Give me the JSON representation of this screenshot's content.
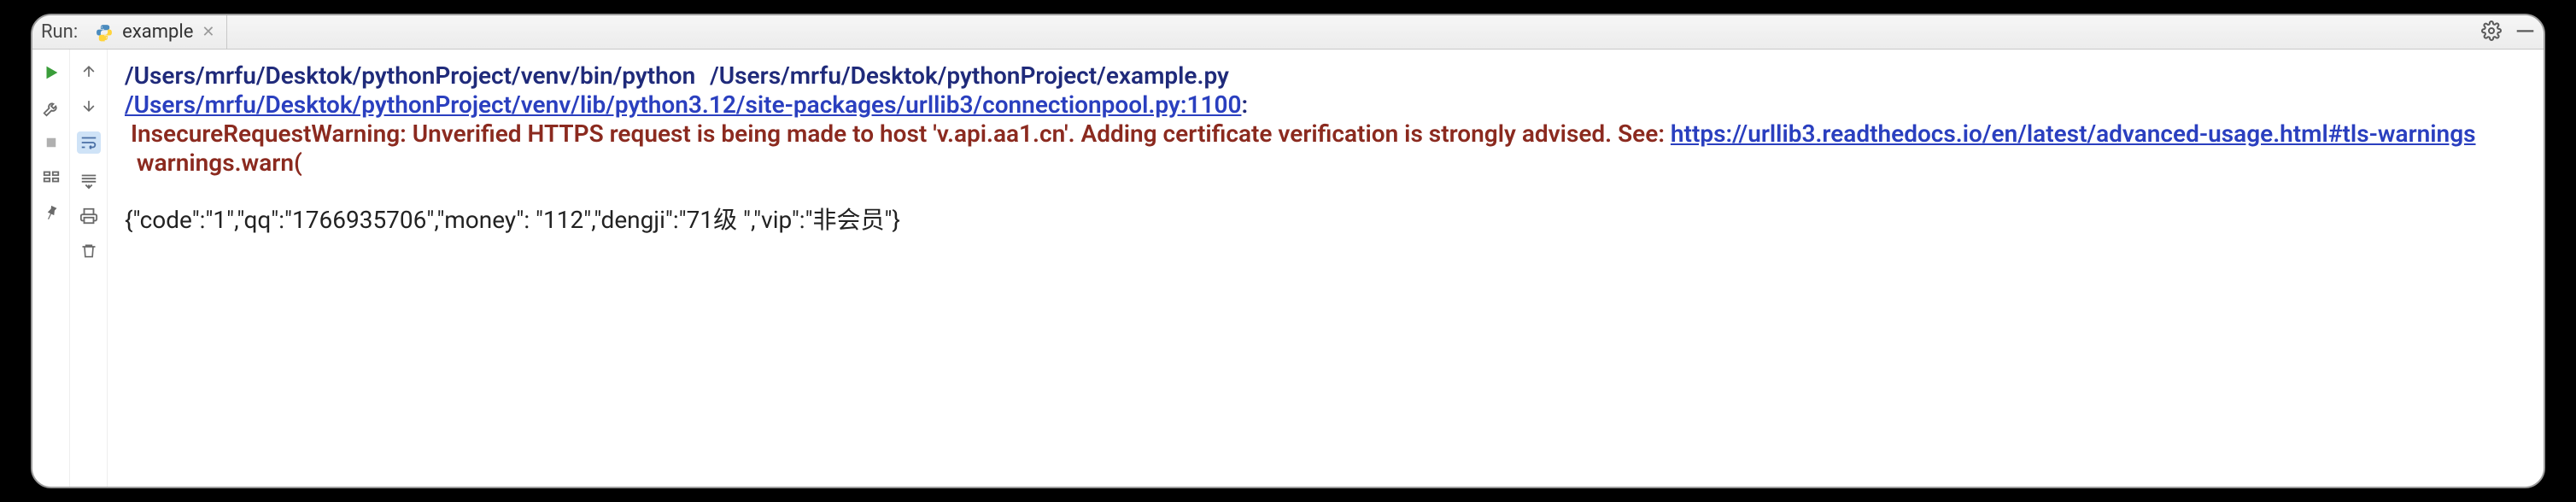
{
  "toolbar": {
    "run_label": "Run:",
    "tab_label": "example",
    "gear_title": "Settings",
    "minimize_title": "Minimize"
  },
  "left_gutter": {
    "rerun_title": "Rerun",
    "wrench_title": "Modify Run Configuration",
    "stop_title": "Stop",
    "layout_title": "Layout",
    "pin_title": "Pin"
  },
  "right_gutter": {
    "up_title": "Up the Stack Trace",
    "down_title": "Down the Stack Trace",
    "softwrap_title": "Soft-Wrap",
    "scroll_title": "Scroll to End",
    "print_title": "Print",
    "clear_title": "Clear All"
  },
  "console": {
    "interpreter": "/Users/mrfu/Desktok/pythonProject/venv/bin/python",
    "script": "/Users/mrfu/Desktok/pythonProject/example.py",
    "trace_link": "/Users/mrfu/Desktok/pythonProject/venv/lib/python3.12/site-packages/urllib3/connectionpool.py:1100",
    "trace_colon": ":",
    "warn_pre": " InsecureRequestWarning: Unverified HTTPS request is being made to host 'v.api.aa1.cn'. Adding certificate verification is strongly advised. See: ",
    "doc_link": "https://urllib3.readthedocs.io/en/latest/advanced-usage.html#tls-warnings",
    "warn_tail": "  warnings.warn(",
    "output": "{\"code\":\"1\",\"qq\":\"1766935706\",\"money\": \"112\",\"dengji\":\"71级 \",\"vip\":\"非会员\"}"
  }
}
